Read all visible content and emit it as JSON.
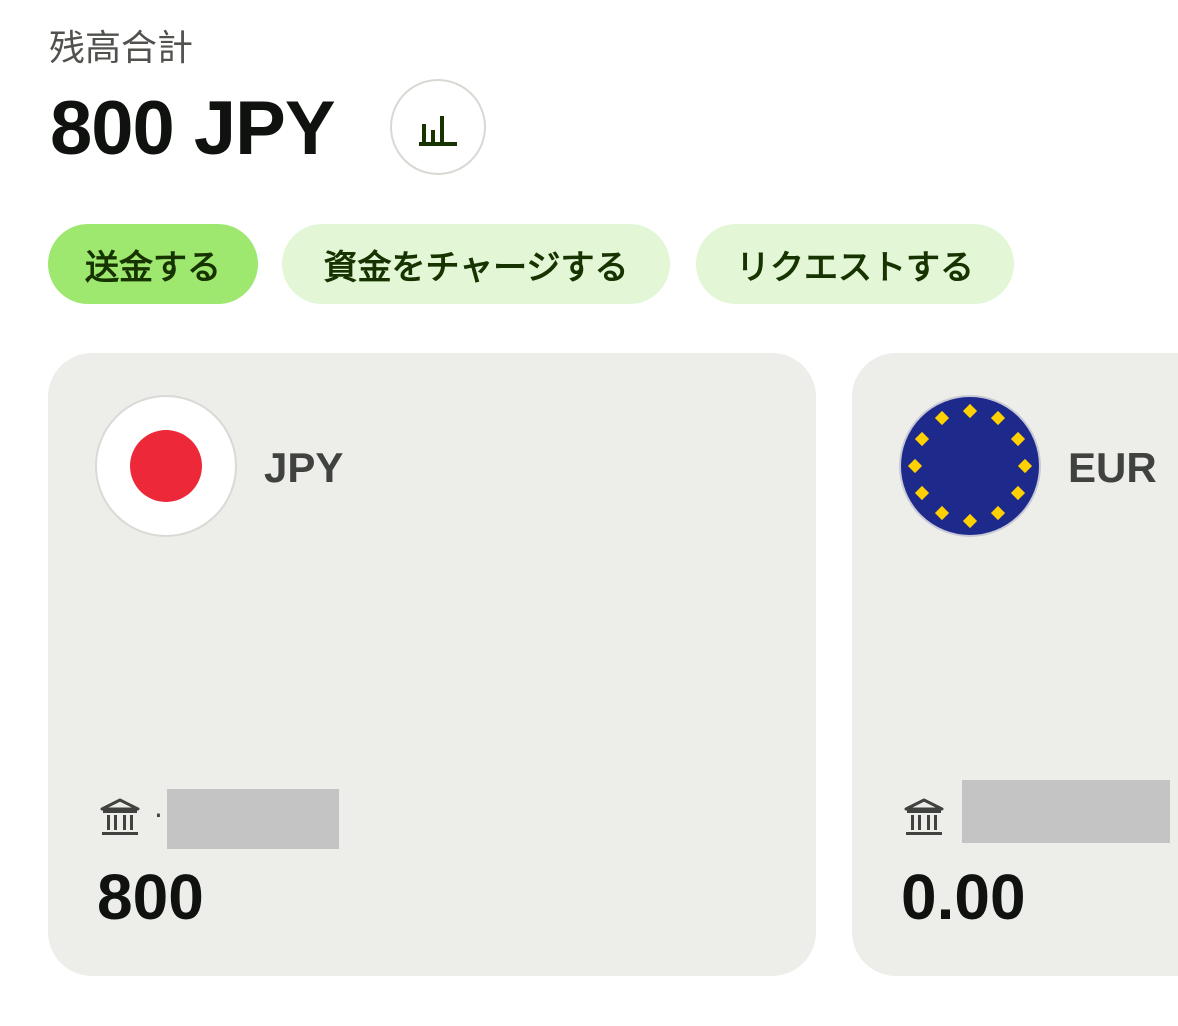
{
  "header": {
    "balance_label": "残高合計",
    "balance_amount": "800 JPY",
    "insights_icon": "bar-chart-icon"
  },
  "actions": [
    {
      "label": "送金する",
      "style": "primary"
    },
    {
      "label": "資金をチャージする",
      "style": "secondary"
    },
    {
      "label": "リクエストする",
      "style": "secondary"
    }
  ],
  "accounts": [
    {
      "currency": "JPY",
      "flag_icon": "japan-flag-icon",
      "bank_icon": "bank-icon",
      "separator": "·",
      "amount": "800"
    },
    {
      "currency": "EUR",
      "flag_icon": "eu-flag-icon",
      "bank_icon": "bank-icon",
      "amount": "0.00"
    }
  ],
  "colors": {
    "primary_action": "#9fe870",
    "secondary_action": "#e3f6d6",
    "action_text": "#163300",
    "card_background": "#edeee9",
    "japan_red": "#ed2939",
    "eu_blue": "#1d2a8c",
    "eu_gold": "#ffd100"
  }
}
